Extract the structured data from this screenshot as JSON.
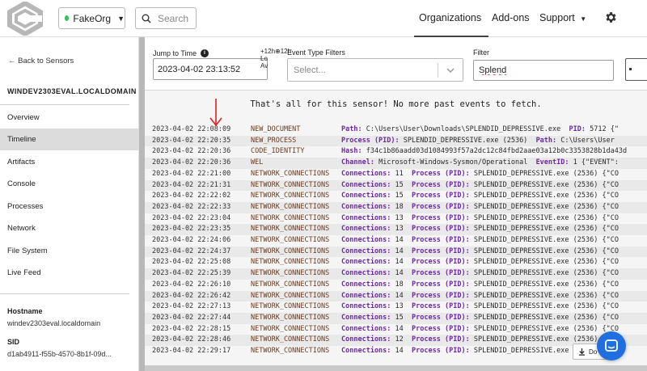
{
  "header": {
    "org_name": "FakeOrg",
    "search_placeholder": "Search",
    "nav": {
      "organizations": "Organizations",
      "addons": "Add-ons",
      "support": "Support"
    }
  },
  "sidebar": {
    "back_label": "← Back to Sensors",
    "sensor_name": "WINDEV2303EVAL.LOCALDOMAIN",
    "items": [
      "Overview",
      "Timeline",
      "Artifacts",
      "Console",
      "Processes",
      "Network",
      "File System",
      "Live Feed"
    ],
    "active_item": "Timeline",
    "hostname_label": "Hostname",
    "hostname_value": "windev2303eval.localdomain",
    "sid_label": "SID",
    "sid_value": "d1ab4911-f55b-4570-8b1f-09d..."
  },
  "filters": {
    "jump_label": "Jump to Time",
    "jump_value": "2023-04-02 23:13:52",
    "overlap_text": "+12h⊕12h\nLo\nAv",
    "event_type_label": "Event Type Filters",
    "event_type_placeholder": "Select...",
    "filter_label": "Filter",
    "filter_value": "Splend"
  },
  "timeline": {
    "done_message": "That's all for this sensor! No more past events to fetch.",
    "rows": [
      {
        "ts": "2023-04-02 22:08:09",
        "type": "NEW_DOCUMENT",
        "k1": "Path:",
        "v1": "C:\\Users\\User\\Downloads\\SPLENDID_DEPRESSIVE.exe",
        "k2": "PID:",
        "v2": "5712  {\""
      },
      {
        "ts": "2023-04-02 22:20:35",
        "type": "NEW_PROCESS",
        "k1": "Process (PID):",
        "v1": "SPLENDID_DEPRESSIVE.exe (2536)",
        "k2": "Path:",
        "v2": "C:\\Users\\User"
      },
      {
        "ts": "2023-04-02 22:20:36",
        "type": "CODE_IDENTITY",
        "k1": "Hash:",
        "v1": "f34c1b86aadd03d1084993f57a2dc12c84fbd2aae03a12b0c3353828b1da43d",
        "k2": "",
        "v2": ""
      },
      {
        "ts": "2023-04-02 22:20:36",
        "type": "WEL",
        "k1": "Channel:",
        "v1": "Microsoft-Windows-Sysmon/Operational",
        "k2": "EventID:",
        "v2": "1  {\"EVENT\":"
      },
      {
        "ts": "2023-04-02 22:21:00",
        "type": "NETWORK_CONNECTIONS",
        "k1": "Connections:",
        "v1": "11",
        "k2": "Process (PID):",
        "v2": "SPLENDID_DEPRESSIVE.exe (2536)  {\"CO"
      },
      {
        "ts": "2023-04-02 22:21:31",
        "type": "NETWORK_CONNECTIONS",
        "k1": "Connections:",
        "v1": "15",
        "k2": "Process (PID):",
        "v2": "SPLENDID_DEPRESSIVE.exe (2536)  {\"CO"
      },
      {
        "ts": "2023-04-02 22:22:02",
        "type": "NETWORK_CONNECTIONS",
        "k1": "Connections:",
        "v1": "15",
        "k2": "Process (PID):",
        "v2": "SPLENDID_DEPRESSIVE.exe (2536)  {\"CO"
      },
      {
        "ts": "2023-04-02 22:22:33",
        "type": "NETWORK_CONNECTIONS",
        "k1": "Connections:",
        "v1": "18",
        "k2": "Process (PID):",
        "v2": "SPLENDID_DEPRESSIVE.exe (2536)  {\"CO"
      },
      {
        "ts": "2023-04-02 22:23:04",
        "type": "NETWORK_CONNECTIONS",
        "k1": "Connections:",
        "v1": "13",
        "k2": "Process (PID):",
        "v2": "SPLENDID_DEPRESSIVE.exe (2536)  {\"CO"
      },
      {
        "ts": "2023-04-02 22:23:35",
        "type": "NETWORK_CONNECTIONS",
        "k1": "Connections:",
        "v1": "13",
        "k2": "Process (PID):",
        "v2": "SPLENDID_DEPRESSIVE.exe (2536)  {\"CO"
      },
      {
        "ts": "2023-04-02 22:24:06",
        "type": "NETWORK_CONNECTIONS",
        "k1": "Connections:",
        "v1": "14",
        "k2": "Process (PID):",
        "v2": "SPLENDID_DEPRESSIVE.exe (2536)  {\"CO"
      },
      {
        "ts": "2023-04-02 22:24:37",
        "type": "NETWORK_CONNECTIONS",
        "k1": "Connections:",
        "v1": "14",
        "k2": "Process (PID):",
        "v2": "SPLENDID_DEPRESSIVE.exe (2536)  {\"CO"
      },
      {
        "ts": "2023-04-02 22:25:08",
        "type": "NETWORK_CONNECTIONS",
        "k1": "Connections:",
        "v1": "14",
        "k2": "Process (PID):",
        "v2": "SPLENDID_DEPRESSIVE.exe (2536)  {\"CO"
      },
      {
        "ts": "2023-04-02 22:25:39",
        "type": "NETWORK_CONNECTIONS",
        "k1": "Connections:",
        "v1": "14",
        "k2": "Process (PID):",
        "v2": "SPLENDID_DEPRESSIVE.exe (2536)  {\"CO"
      },
      {
        "ts": "2023-04-02 22:26:10",
        "type": "NETWORK_CONNECTIONS",
        "k1": "Connections:",
        "v1": "18",
        "k2": "Process (PID):",
        "v2": "SPLENDID_DEPRESSIVE.exe (2536)  {\"CO"
      },
      {
        "ts": "2023-04-02 22:26:42",
        "type": "NETWORK_CONNECTIONS",
        "k1": "Connections:",
        "v1": "14",
        "k2": "Process (PID):",
        "v2": "SPLENDID_DEPRESSIVE.exe (2536)  {\"CO"
      },
      {
        "ts": "2023-04-02 22:27:13",
        "type": "NETWORK_CONNECTIONS",
        "k1": "Connections:",
        "v1": "13",
        "k2": "Process (PID):",
        "v2": "SPLENDID_DEPRESSIVE.exe (2536)  {\"CO"
      },
      {
        "ts": "2023-04-02 22:27:44",
        "type": "NETWORK_CONNECTIONS",
        "k1": "Connections:",
        "v1": "15",
        "k2": "Process (PID):",
        "v2": "SPLENDID_DEPRESSIVE.exe (2536)  {\"CO"
      },
      {
        "ts": "2023-04-02 22:28:15",
        "type": "NETWORK_CONNECTIONS",
        "k1": "Connections:",
        "v1": "14",
        "k2": "Process (PID):",
        "v2": "SPLENDID_DEPRESSIVE.exe (2536)  {\"CO"
      },
      {
        "ts": "2023-04-02 22:28:46",
        "type": "NETWORK_CONNECTIONS",
        "k1": "Connections:",
        "v1": "12",
        "k2": "Process (PID):",
        "v2": "SPLENDID_DEPRESSIVE.exe (2536)  {\"CO"
      },
      {
        "ts": "2023-04-02 22:29:17",
        "type": "NETWORK_CONNECTIONS",
        "k1": "Connections:",
        "v1": "14",
        "k2": "Process (PID):",
        "v2": "SPLENDID_DEPRESSIVE.exe (2536)  {\"CO"
      }
    ],
    "download_label": "Do"
  },
  "colors": {
    "accent": "#1f6fe0",
    "status_online": "#33c25b",
    "event_type": "#6b3a1f",
    "field_key": "#6b2aa0",
    "annotation_arrow": "#e02020"
  },
  "icons": [
    "logo-icon",
    "search-icon",
    "chevron-down-icon",
    "gear-icon",
    "info-icon",
    "down-arrow-annotation-icon",
    "download-icon",
    "chat-icon"
  ]
}
